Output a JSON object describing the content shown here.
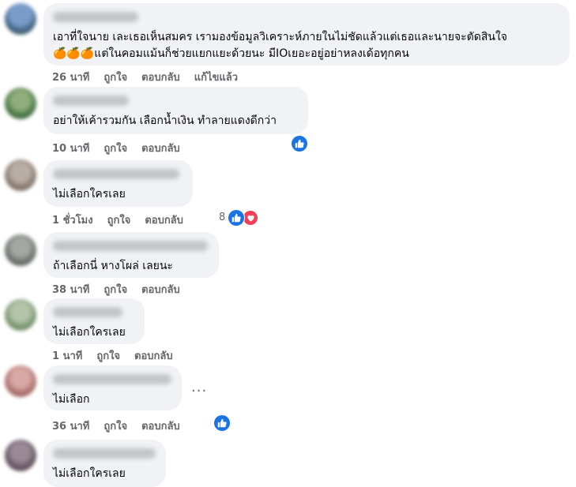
{
  "comments": [
    {
      "line1": "เอาที่ใจนาย เละเธอเห็นสมคร เรามองข้อมูลวิเคราะห์ภายในไม่ชัดแล้วแต่เธอและนายจะตัดสินใจ",
      "line2_emoji": "🍊🍊🍊",
      "line2_text": "แต่ในคอมแม้นก็ช่วยแยกแยะด้วยนะ มีIOเยอะอยู่อย่าหลงเด้อทุกคน",
      "time": "26 นาที",
      "like": "ถูกใจ",
      "reply": "ตอบกลับ",
      "edited": "แก้ไขแล้ว"
    },
    {
      "text": "อย่าให้เค้ารวมกัน เลือกน้ำเงิน ทำลายแดงดีกว่า",
      "time": "10 นาที",
      "like": "ถูกใจ",
      "reply": "ตอบกลับ"
    },
    {
      "text": "ไม่เลือกใครเลย",
      "time": "1 ชั่วโมง",
      "like": "ถูกใจ",
      "reply": "ตอบกลับ",
      "reaction_count": "8"
    },
    {
      "text": "ถ้าเลือกนี่ หางโผล่ เลยนะ",
      "time": "38 นาที",
      "like": "ถูกใจ",
      "reply": "ตอบกลับ"
    },
    {
      "text": "ไม่เลือกใครเลย",
      "time": "1 นาที",
      "like": "ถูกใจ",
      "reply": "ตอบกลับ"
    },
    {
      "text": "ไม่เลือก",
      "time": "36 นาที",
      "like": "ถูกใจ",
      "reply": "ตอบกลับ",
      "more": "..."
    },
    {
      "text": "ไม่เลือกใครเลย"
    }
  ],
  "colors": {
    "bubble": "#f0f2f5",
    "like_blue": "#1b74e4",
    "heart_red": "#f33e58",
    "meta_gray": "#65676b"
  },
  "icons": [
    "like-icon",
    "heart-icon",
    "more-options-icon"
  ]
}
